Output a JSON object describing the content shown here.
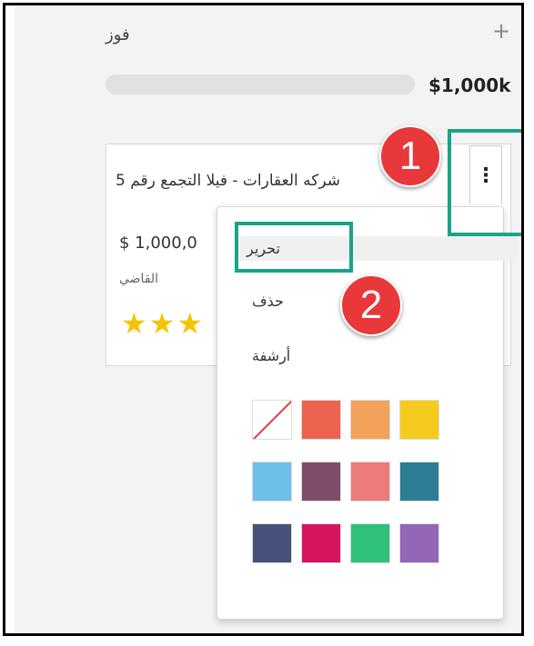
{
  "column": {
    "title": "فوز",
    "add_icon": "plus-icon",
    "amount": "$1,000k"
  },
  "card": {
    "name": "شركه العقارات - فيلا التجمع رقم 5",
    "price": "$ 1,000,0",
    "person": "القاضي",
    "stars": "★★★",
    "menu_icon": "kebab-menu-icon"
  },
  "menu": {
    "edit_label": "تحرير",
    "delete_label": "حذف",
    "archive_label": "أرشفة",
    "colors": [
      "none",
      "#ec6450",
      "#f2a25b",
      "#f5cb1d",
      "#6ec0ea",
      "#7e4d6b",
      "#ec7b79",
      "#2b7e94",
      "#46507a",
      "#d6145f",
      "#2fc07a",
      "#9366b6"
    ]
  },
  "annotations": {
    "step1": "1",
    "step2": "2"
  }
}
